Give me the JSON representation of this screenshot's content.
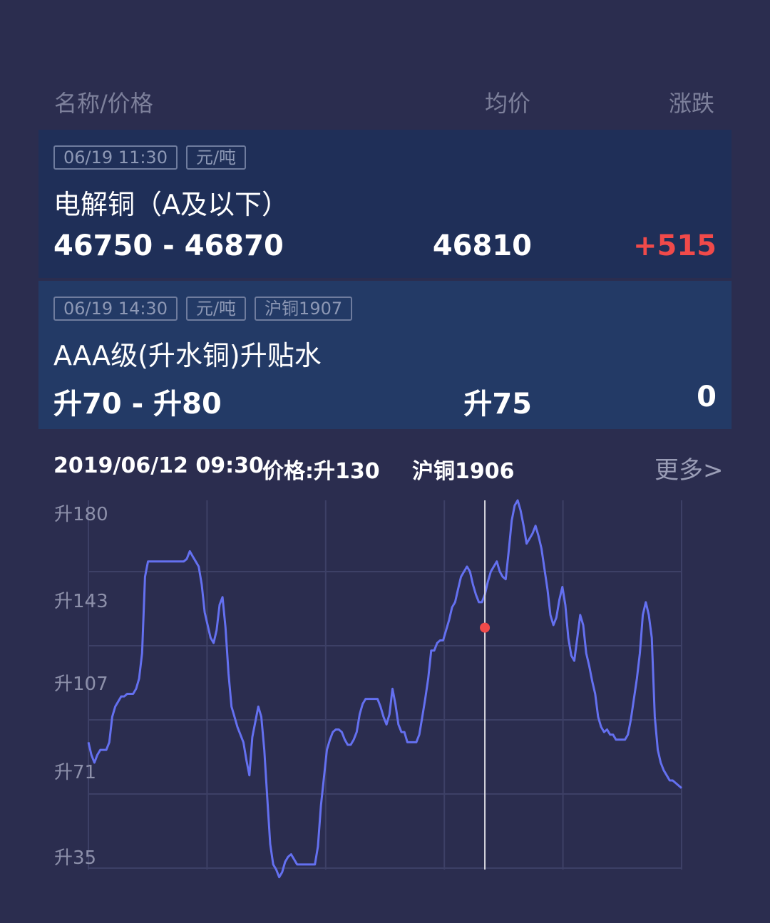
{
  "header": {
    "col_name": "名称/价格",
    "col_avg": "均价",
    "col_change": "涨跌"
  },
  "cards": [
    {
      "tags": [
        "06/19 11:30",
        "元/吨"
      ],
      "name": "电解铜（A及以下）",
      "range": "46750 - 46870",
      "avg": "46810",
      "change": "+515",
      "change_color": "#f04a4a"
    },
    {
      "tags": [
        "06/19 14:30",
        "元/吨",
        "沪铜1907"
      ],
      "name": "AAA级(升水铜)升贴水",
      "range": "升70 - 升80",
      "avg": "升75",
      "change": "0",
      "change_color": "#ffffff"
    }
  ],
  "chart_info": {
    "datetime": "2019/06/12 09:30",
    "price": "价格:升130",
    "contract": "沪铜1906",
    "more": "更多>"
  },
  "colors": {
    "background": "#2b2d4f",
    "line": "#6470f0",
    "marker": "#f04a4a",
    "grid": "#3d4066"
  },
  "chart_data": {
    "type": "line",
    "y_tick_labels": [
      "升180",
      "升143",
      "升107",
      "升71",
      "升35"
    ],
    "y_ticks": [
      180,
      143,
      107,
      71,
      35
    ],
    "ylim": [
      35,
      180
    ],
    "grid": true,
    "highlight": {
      "label": "2019/06/12 09:30",
      "value": 130,
      "index": 133
    },
    "series": [
      {
        "values": [
          85,
          80,
          77,
          80,
          82,
          82,
          82,
          85,
          95,
          99,
          101,
          103,
          103,
          104,
          104,
          104,
          106,
          110,
          120,
          150,
          156,
          156,
          156,
          156,
          156,
          156,
          156,
          156,
          156,
          156,
          156,
          156,
          156,
          157,
          160,
          158,
          156,
          154,
          147,
          136,
          131,
          126,
          124,
          129,
          139,
          142,
          130,
          112,
          99,
          95,
          91,
          88,
          85,
          78,
          72,
          87,
          93,
          99,
          95,
          82,
          63,
          45,
          37,
          35,
          32,
          34,
          38,
          40,
          41,
          39,
          37,
          37,
          37,
          37,
          37,
          37,
          37,
          44,
          60,
          71,
          82,
          86,
          89,
          90,
          90,
          89,
          86,
          84,
          84,
          86,
          89,
          96,
          100,
          102,
          102,
          102,
          102,
          102,
          99,
          95,
          92,
          96,
          106,
          100,
          92,
          89,
          89,
          85,
          85,
          85,
          85,
          88,
          95,
          102,
          110,
          121,
          121,
          124,
          125,
          125,
          129,
          133,
          138,
          140,
          145,
          150,
          152,
          154,
          152,
          147,
          143,
          140,
          140,
          143,
          148,
          152,
          154,
          156,
          152,
          150,
          149,
          160,
          172,
          178,
          180,
          176,
          170,
          163,
          165,
          167,
          170,
          166,
          161,
          153,
          145,
          135,
          131,
          134,
          141,
          146,
          139,
          126,
          119,
          117,
          126,
          135,
          131,
          120,
          115,
          109,
          104,
          95,
          91,
          89,
          90,
          88,
          88,
          86,
          86,
          86,
          86,
          88,
          94,
          102,
          110,
          120,
          135,
          140,
          135,
          126,
          95,
          82,
          77,
          74,
          72,
          70,
          70,
          69,
          68,
          67
        ]
      }
    ]
  }
}
